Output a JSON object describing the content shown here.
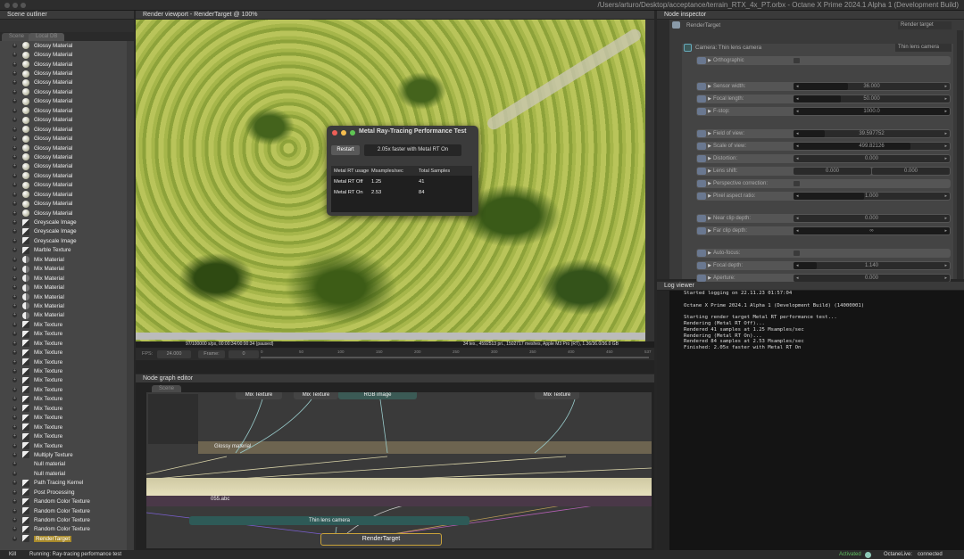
{
  "window": {
    "title": "/Users/arturo/Desktop/acceptance/terrain_RTX_4x_PT.orbx - Octane X Prime 2024.1 Alpha 1 (Development Build)"
  },
  "outliner": {
    "title": "Scene outliner",
    "tabs": [
      "Scene",
      "Local DB"
    ],
    "items": [
      {
        "label": "Glossy Material",
        "icon": "sphere"
      },
      {
        "label": "Glossy Material",
        "icon": "sphere"
      },
      {
        "label": "Glossy Material",
        "icon": "sphere"
      },
      {
        "label": "Glossy Material",
        "icon": "sphere"
      },
      {
        "label": "Glossy Material",
        "icon": "sphere"
      },
      {
        "label": "Glossy Material",
        "icon": "sphere"
      },
      {
        "label": "Glossy Material",
        "icon": "sphere"
      },
      {
        "label": "Glossy Material",
        "icon": "sphere"
      },
      {
        "label": "Glossy Material",
        "icon": "sphere"
      },
      {
        "label": "Glossy Material",
        "icon": "sphere"
      },
      {
        "label": "Glossy Material",
        "icon": "sphere"
      },
      {
        "label": "Glossy Material",
        "icon": "sphere"
      },
      {
        "label": "Glossy Material",
        "icon": "sphere"
      },
      {
        "label": "Glossy Material",
        "icon": "sphere"
      },
      {
        "label": "Glossy Material",
        "icon": "sphere"
      },
      {
        "label": "Glossy Material",
        "icon": "sphere"
      },
      {
        "label": "Glossy Material",
        "icon": "sphere"
      },
      {
        "label": "Glossy Material",
        "icon": "sphere"
      },
      {
        "label": "Glossy Material",
        "icon": "sphere"
      },
      {
        "label": "Greyscale Image",
        "icon": "texture"
      },
      {
        "label": "Greyscale Image",
        "icon": "texture"
      },
      {
        "label": "Greyscale Image",
        "icon": "texture"
      },
      {
        "label": "Marble Texture",
        "icon": "texture"
      },
      {
        "label": "Mix Material",
        "icon": "mix"
      },
      {
        "label": "Mix Material",
        "icon": "mix"
      },
      {
        "label": "Mix Material",
        "icon": "mix"
      },
      {
        "label": "Mix Material",
        "icon": "mix"
      },
      {
        "label": "Mix Material",
        "icon": "mix"
      },
      {
        "label": "Mix Material",
        "icon": "mix"
      },
      {
        "label": "Mix Material",
        "icon": "mix"
      },
      {
        "label": "Mix Texture",
        "icon": "texture"
      },
      {
        "label": "Mix Texture",
        "icon": "texture"
      },
      {
        "label": "Mix Texture",
        "icon": "texture"
      },
      {
        "label": "Mix Texture",
        "icon": "texture"
      },
      {
        "label": "Mix Texture",
        "icon": "texture"
      },
      {
        "label": "Mix Texture",
        "icon": "texture"
      },
      {
        "label": "Mix Texture",
        "icon": "texture"
      },
      {
        "label": "Mix Texture",
        "icon": "texture"
      },
      {
        "label": "Mix Texture",
        "icon": "texture"
      },
      {
        "label": "Mix Texture",
        "icon": "texture"
      },
      {
        "label": "Mix Texture",
        "icon": "texture"
      },
      {
        "label": "Mix Texture",
        "icon": "texture"
      },
      {
        "label": "Mix Texture",
        "icon": "texture"
      },
      {
        "label": "Mix Texture",
        "icon": "texture"
      },
      {
        "label": "Multiply Texture",
        "icon": "texture"
      },
      {
        "label": "Null material",
        "icon": "none"
      },
      {
        "label": "Null material",
        "icon": "none"
      },
      {
        "label": "Path Tracing Kernel",
        "icon": "texture"
      },
      {
        "label": "Post Processing",
        "icon": "texture"
      },
      {
        "label": "Random Color Texture",
        "icon": "texture"
      },
      {
        "label": "Random Color Texture",
        "icon": "texture"
      },
      {
        "label": "Random Color Texture",
        "icon": "texture"
      },
      {
        "label": "Random Color Texture",
        "icon": "texture"
      },
      {
        "label": "RenderTarget",
        "icon": "texture",
        "selected": true
      }
    ]
  },
  "viewport": {
    "title": "Render viewport - RenderTarget @ 100%",
    "stats_left": "97/100000 s/px, 00:00:34/00:00:34 (paused)",
    "stats_right": "34 tex., 4592513 pri., 1502717 meshes, Apple M3 Pro (RT), 1.36/36.0/36.0 GB",
    "fps_label": "FPS:",
    "fps": "24.000",
    "frame_label": "Frame:",
    "frame": "0",
    "ticks": [
      "0",
      "50",
      "100",
      "150",
      "200",
      "250",
      "300",
      "350",
      "400",
      "450",
      "537"
    ]
  },
  "dialog": {
    "title": "Metal Ray-Tracing Performance Test",
    "restart": "Restart",
    "result": "2.05x faster with Metal RT On",
    "columns": [
      "Metal RT usage",
      "Msamples/sec",
      "Total Samples"
    ],
    "rows": [
      [
        "Metal RT Off",
        "1.25",
        "41"
      ],
      [
        "Metal RT On",
        "2.53",
        "84"
      ]
    ]
  },
  "graph": {
    "title": "Node graph editor",
    "tab": "Scene",
    "nodes": {
      "mix1": "Mix Texture",
      "mix2": "Mix Texture",
      "rgb": "RGB image",
      "mix3": "Mix Texture",
      "gloss": "Glossy material",
      "abc": "055.abc",
      "camera": "Thin lens camera",
      "rt": "RenderTarget"
    }
  },
  "inspector": {
    "title": "Node inspector",
    "node": "RenderTarget",
    "node_type": "Render target",
    "camera_label": "Camera: Thin lens camera",
    "camera_type": "Thin lens camera",
    "params": [
      {
        "label": "Orthographic",
        "type": "bool",
        "value": false
      },
      {
        "label": "Sensor width:",
        "value": "36.000",
        "fill": 0.35
      },
      {
        "label": "Focal length:",
        "value": "50.000",
        "fill": 0.3
      },
      {
        "label": "F-stop:",
        "value": "1000.0",
        "fill": 1.0
      },
      {
        "label": "Field of view:",
        "value": "39.597752",
        "fill": 0.2
      },
      {
        "label": "Scale of view:",
        "value": "499.82126",
        "fill": 0.75
      },
      {
        "label": "Distortion:",
        "value": "0.000",
        "fill": 0
      },
      {
        "label": "Lens shift:",
        "value": "0.000",
        "value2": "0.000",
        "type": "pair"
      },
      {
        "label": "Perspective correction:",
        "type": "bool",
        "value": false
      },
      {
        "label": "Pixel aspect ratio:",
        "value": "1.000",
        "fill": 0.45
      },
      {
        "label": "Near clip depth:",
        "value": "0.000",
        "fill": 0
      },
      {
        "label": "Far clip depth:",
        "value": "∞",
        "fill": 1.0
      },
      {
        "label": "Auto-focus:",
        "type": "bool",
        "value": false
      },
      {
        "label": "Focal depth:",
        "value": "1.140",
        "fill": 0.15
      },
      {
        "label": "Aperture:",
        "value": "0.000",
        "fill": 0
      }
    ]
  },
  "log": {
    "title": "Log viewer",
    "lines": [
      "Started logging on 22.11.23 01:57:04",
      "",
      "Octane X Prime 2024.1 Alpha 1 (Development Build) (14000001)",
      "",
      "Starting render target Metal RT performance test...",
      "Rendering (Metal RT Off)...",
      "Rendered 41 samples at 1.25 Msamples/sec",
      "Rendering (Metal RT On)...",
      "Rendered 84 samples at 2.53 Msamples/sec",
      "Finished: 2.05x faster with Metal RT On",
      ""
    ]
  },
  "status": {
    "kill": "Kill",
    "message": "Running: Ray-tracing performance test",
    "activated": "Activated",
    "live_label": "OctaneLive:",
    "live_status": "connected",
    "accent": "#5fbf5f"
  }
}
